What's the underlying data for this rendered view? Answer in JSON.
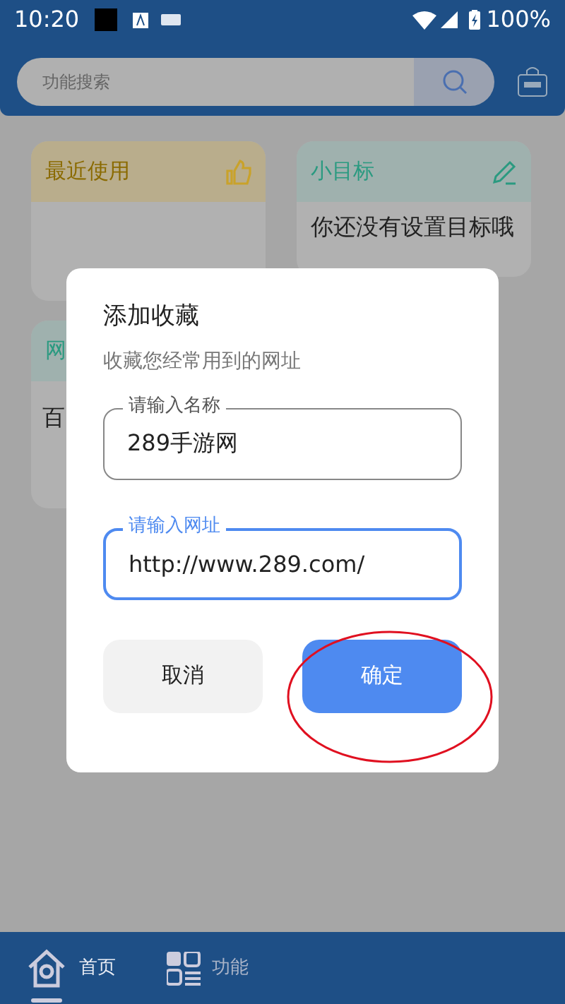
{
  "status_bar": {
    "time": "10:20",
    "battery": "100%"
  },
  "search": {
    "placeholder": "功能搜索"
  },
  "cards": [
    {
      "kind": "recent",
      "title": "最近使用"
    },
    {
      "kind": "goal",
      "title": "小目标",
      "text": "你还没有设置目标哦"
    },
    {
      "kind": "sites",
      "title": "网",
      "text": "百"
    }
  ],
  "dialog": {
    "title": "添加收藏",
    "subtitle": "收藏您经常用到的网址",
    "fields": [
      {
        "label": "请输入名称",
        "value": "289手游网",
        "focused": false
      },
      {
        "label": "请输入网址",
        "value": "http://www.289.com/",
        "focused": true
      }
    ],
    "buttons": [
      {
        "label": "取消",
        "kind": "cancel"
      },
      {
        "label": "确定",
        "kind": "confirm"
      }
    ]
  },
  "tabs": [
    {
      "label": "首页",
      "selected": true
    },
    {
      "label": "功能",
      "selected": false
    }
  ]
}
